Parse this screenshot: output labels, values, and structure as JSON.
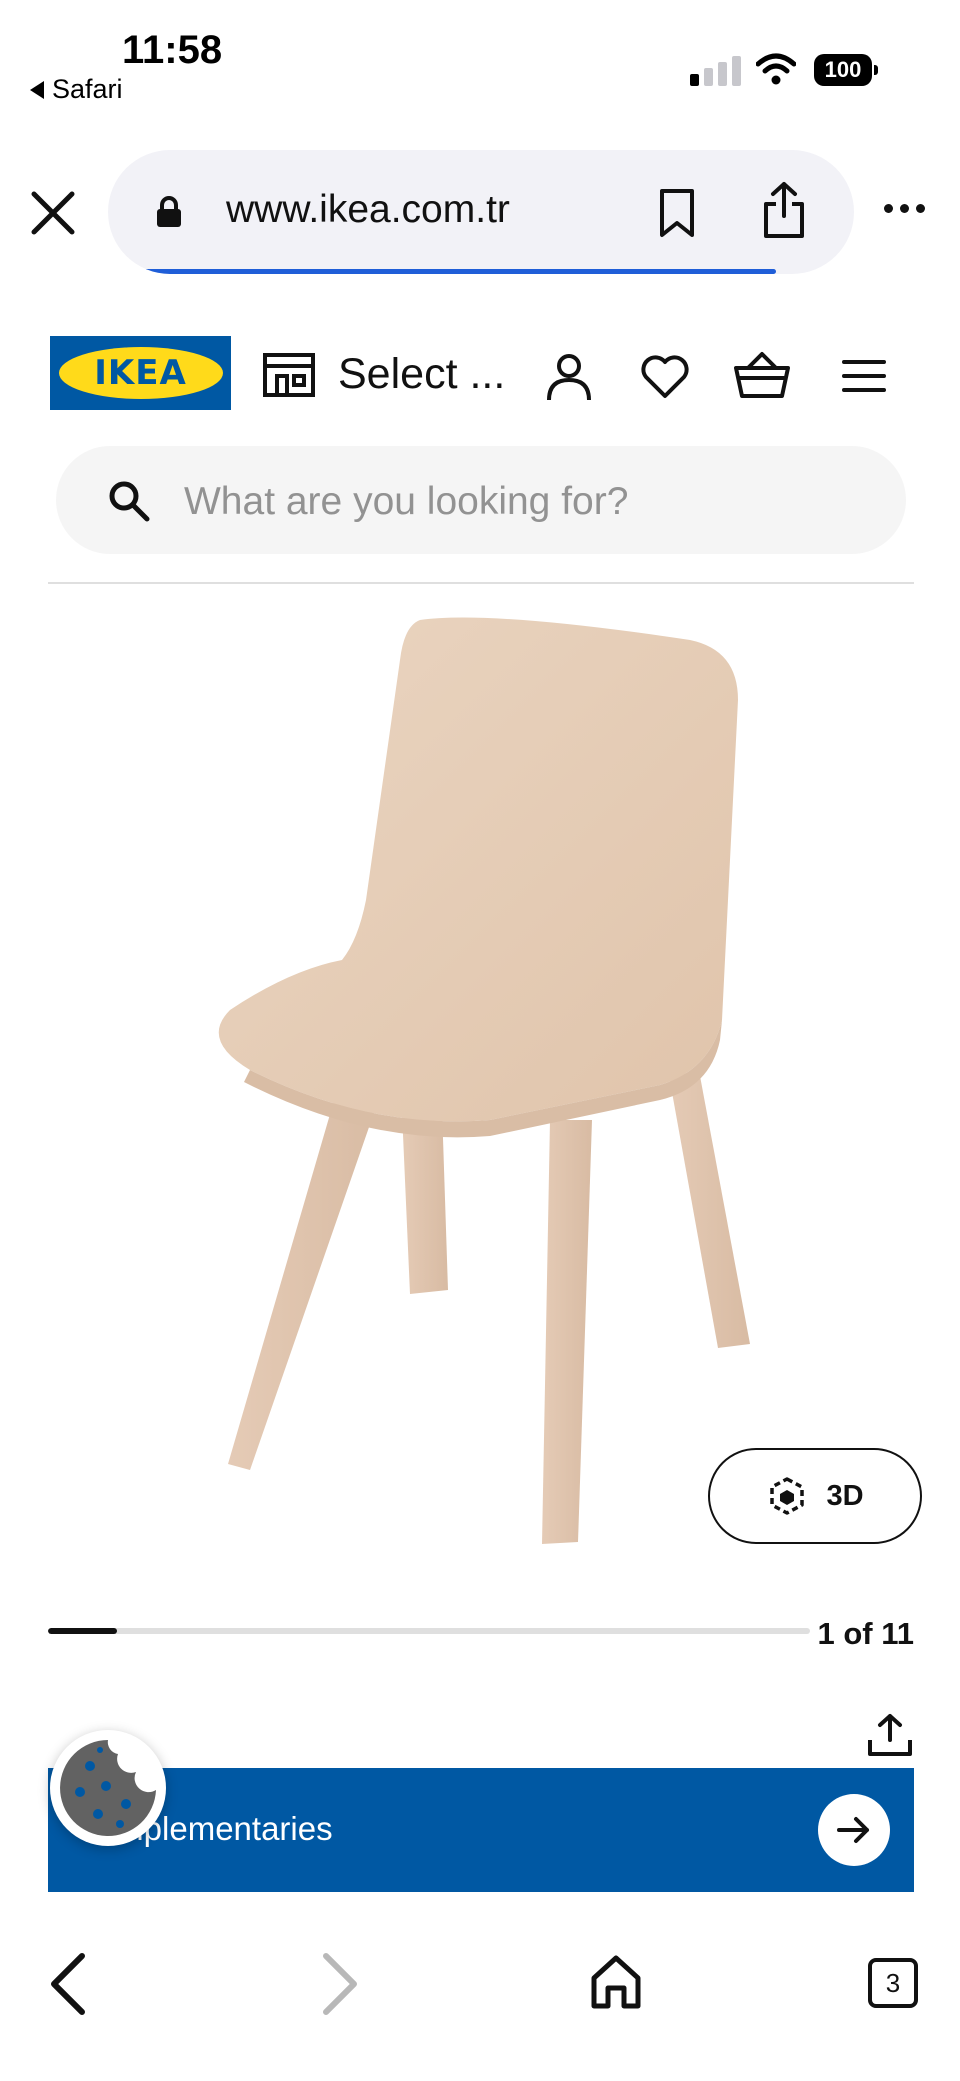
{
  "status_bar": {
    "time": "11:58",
    "back_app": "Safari",
    "battery": "100"
  },
  "browser": {
    "url": "www.ikea.com.tr",
    "tab_count": "3"
  },
  "header": {
    "logo_text": "IKEA",
    "store_label": "Select ..."
  },
  "search": {
    "placeholder": "What are you looking for?"
  },
  "product_gallery": {
    "view_3d_label": "3D",
    "image_counter": "1 of 11",
    "current_image": 1,
    "total_images": 11
  },
  "banner": {
    "label": "Complementaries"
  },
  "colors": {
    "ikea_blue": "#0058a3",
    "ikea_yellow": "#ffda1a",
    "url_progress_blue": "#1f5ed8"
  }
}
